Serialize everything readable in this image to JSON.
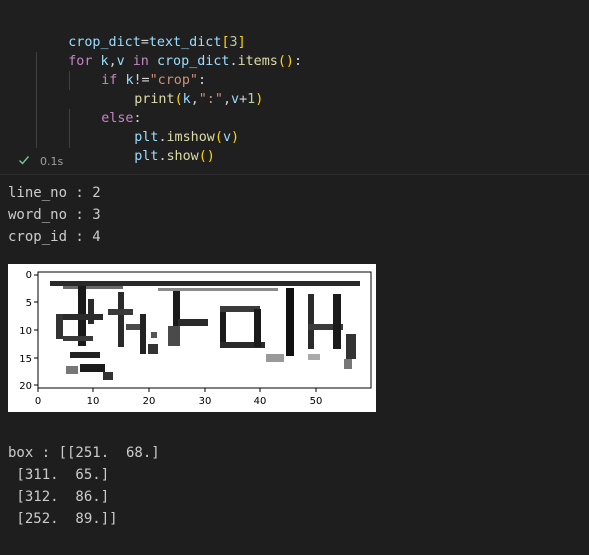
{
  "cell": {
    "code_lines": [
      "crop_dict=text_dict[3]",
      "for k,v in crop_dict.items():",
      "if k!=\"crop\":",
      "print(k,\":\",v+1)",
      "else:",
      "plt.imshow(v)",
      "plt.show()"
    ],
    "exec_time": "0.1s",
    "status_icon": "check-icon",
    "status_color": "#73c991"
  },
  "output": {
    "text_lines": [
      "line_no : 2",
      "word_no : 3",
      "crop_id : 4"
    ],
    "box_lines": [
      "box : [[251.  68.]",
      " [311.  65.]",
      " [312.  86.]",
      " [252.  89.]]"
    ]
  },
  "chart_data": {
    "type": "heatmap",
    "colormap": "grayscale (dark strokes on white)",
    "x_ticks": [
      "0",
      "10",
      "20",
      "30",
      "40",
      "50"
    ],
    "y_ticks": [
      "0",
      "5",
      "10",
      "15",
      "20"
    ],
    "xlim": [
      -0.5,
      58.5
    ],
    "ylim": [
      20.5,
      -0.5
    ],
    "grid": false,
    "content": "cropped handwritten Bengali word image"
  }
}
